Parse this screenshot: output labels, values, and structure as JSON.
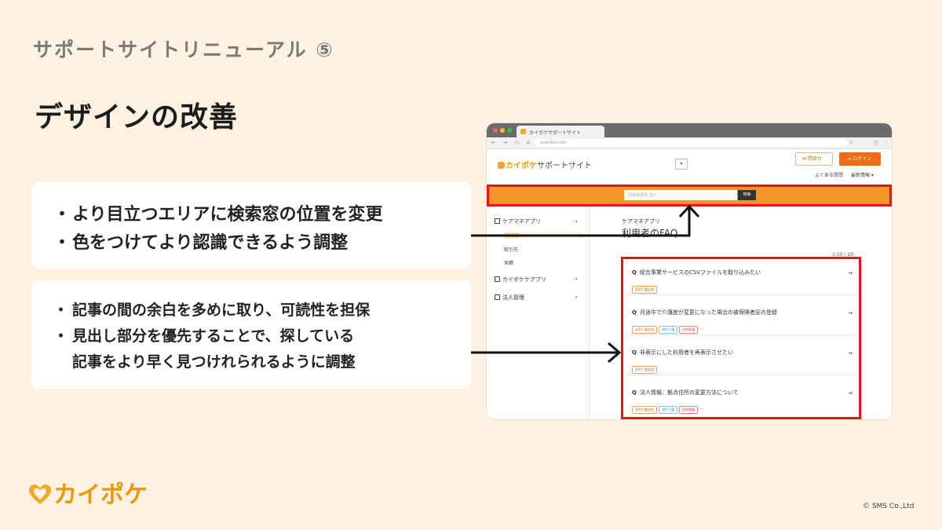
{
  "slide": {
    "section_label": "サポートサイトリニューアル ⑤",
    "title": "デザインの改善",
    "point_group_1": [
      "より目立つエリアに検索窓の位置を変更",
      "色をつけてより認識できるよう調整"
    ],
    "point_group_2": [
      "記事の間の余白を多めに取り、可読性を担保",
      "見出し部分を優先することで、探している",
      "記事をより早く見つけれられるように調整"
    ],
    "bullet": "・",
    "brand": "カイポケ",
    "copyright": "© SMS Co.,Ltd"
  },
  "browser": {
    "tab_title": "カイポケサポートサイト",
    "url": "example.com",
    "nav_glyphs": "← → ○ ⌂",
    "site": {
      "logo_brand": "カイポケ",
      "logo_sub": "サポートサイト",
      "dropdown_glyph": "▾",
      "contact_label": "問合せ",
      "login_label": "ログイン",
      "subnav": [
        "よくある質問",
        "最新情報 ▾"
      ],
      "search_placeholder": "国保連請求 流れ",
      "search_button": "検索",
      "sidebar": {
        "groups": [
          {
            "label": "ケアマネアプリ",
            "chevron": "▴"
          },
          {
            "label": "カイポケケアプリ",
            "chevron": "▾"
          },
          {
            "label": "法人管理",
            "chevron": "▾"
          }
        ],
        "sub_items": [
          "利用者",
          "取引先",
          "実績"
        ]
      },
      "breadcrumb": "ケアマネアプリ",
      "faq_title": "利用者のFAQ",
      "count": "1-10 / 20",
      "faqs": [
        {
          "q": "総合事業サービスのCSVファイルを取り込みたい",
          "tags": [
            "居宅介護支援"
          ]
        },
        {
          "q": "月途中で介護度が変更になった場合の被保険者証の登録",
          "tags": [
            "居宅介護支援",
            "通所介護",
            "訪問看護"
          ]
        },
        {
          "q": "非表示にした利用者を再表示させたい",
          "tags": [
            "居宅介護支援"
          ]
        },
        {
          "q": "法人情報、拠点住所の変更方法について",
          "tags": [
            "居宅介護支援",
            "通所介護",
            "訪問看護"
          ]
        }
      ],
      "q_marker": "Q",
      "arrow_glyph": "→",
      "more_glyph": "···"
    }
  },
  "colors": {
    "background": "#fef3e2",
    "brand_orange": "#f29600",
    "search_band": "#f5962a",
    "highlight_red": "#e8141b"
  }
}
